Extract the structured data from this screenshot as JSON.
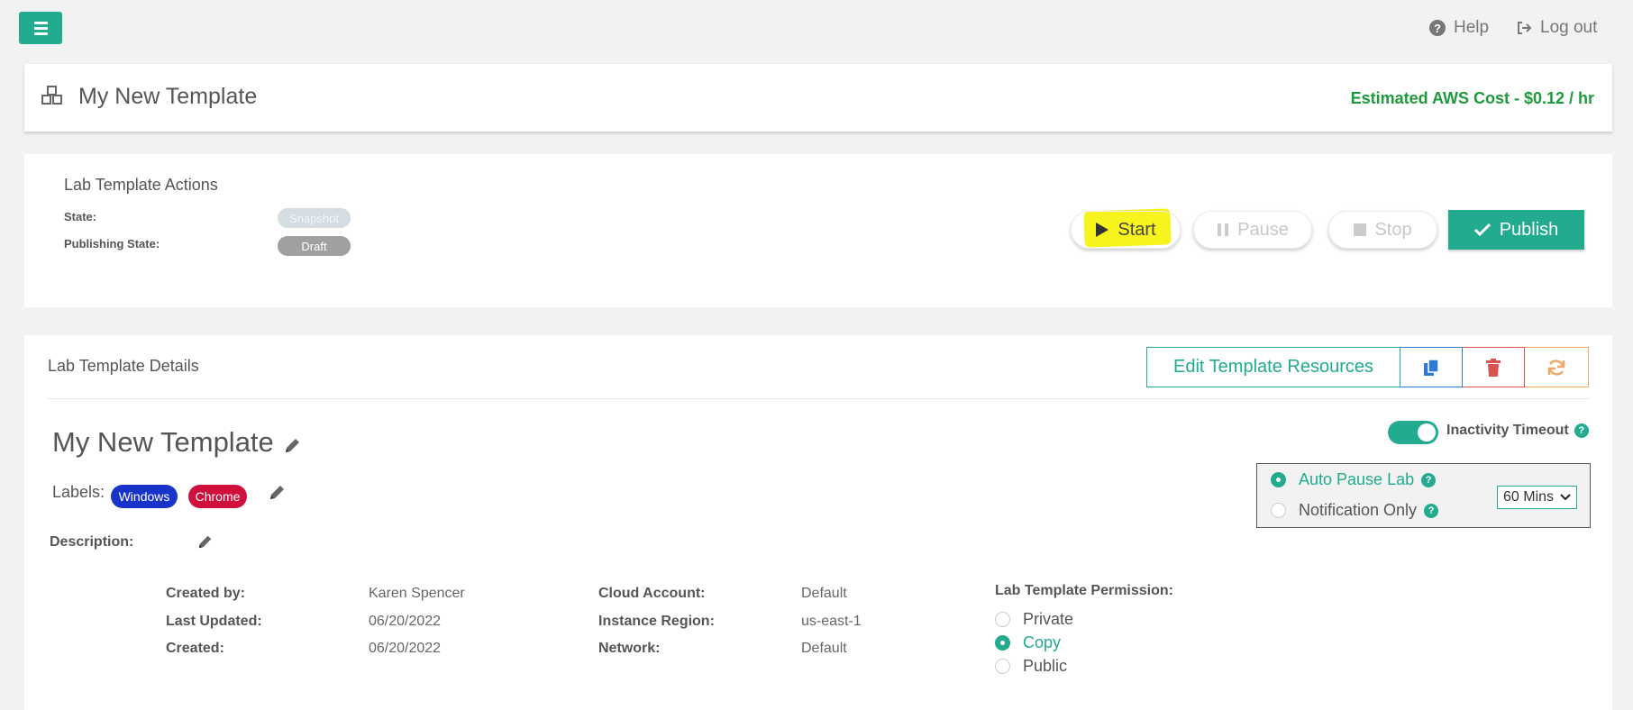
{
  "topbar": {
    "help_label": "Help",
    "logout_label": "Log out"
  },
  "header": {
    "title": "My New Template",
    "aws_cost": "Estimated AWS Cost - $0.12 / hr"
  },
  "actions": {
    "title": "Lab Template Actions",
    "state_label": "State:",
    "state_value": "Snapshot",
    "publishing_label": "Publishing State:",
    "publishing_value": "Draft",
    "start_label": "Start",
    "pause_label": "Pause",
    "stop_label": "Stop",
    "publish_label": "Publish"
  },
  "details": {
    "title": "Lab Template Details",
    "edit_resources_label": "Edit Template Resources",
    "template_name": "My New Template",
    "labels_label": "Labels:",
    "labels": [
      "Windows",
      "Chrome"
    ],
    "description_label": "Description:",
    "meta_left": [
      {
        "label": "Created by:",
        "value": "Karen Spencer"
      },
      {
        "label": "Last Updated:",
        "value": "06/20/2022"
      },
      {
        "label": "Created:",
        "value": "06/20/2022"
      }
    ],
    "meta_right": [
      {
        "label": "Cloud Account:",
        "value": "Default"
      },
      {
        "label": "Instance Region:",
        "value": "us-east-1"
      },
      {
        "label": "Network:",
        "value": "Default"
      }
    ],
    "permission": {
      "title": "Lab Template Permission:",
      "options": [
        "Private",
        "Copy",
        "Public"
      ],
      "selected": "Copy"
    },
    "inactivity": {
      "label": "Inactivity Timeout",
      "enabled": true,
      "options": [
        "Auto Pause Lab",
        "Notification Only"
      ],
      "selected": "Auto Pause Lab",
      "duration": "60 Mins"
    }
  },
  "colors": {
    "accent": "#22ab8f",
    "cost_green": "#1c9a3d",
    "highlight": "#f7f31c",
    "windows_tag": "#1833c9",
    "chrome_tag": "#d10f3d"
  }
}
